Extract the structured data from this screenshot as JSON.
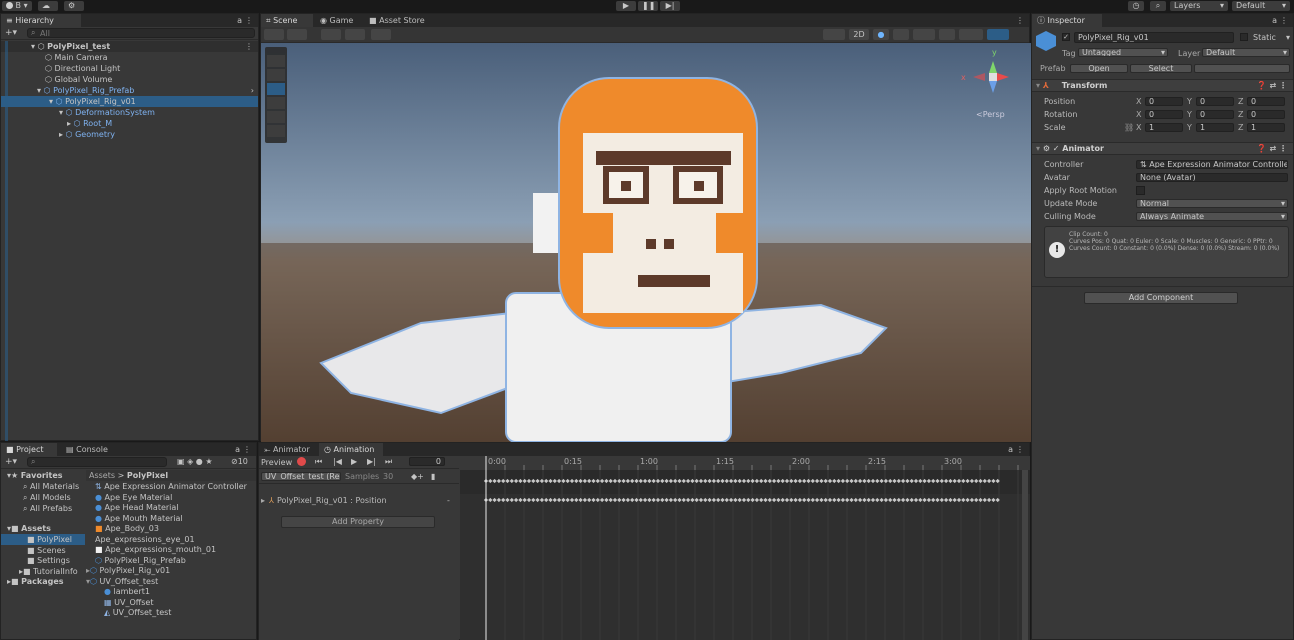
{
  "toolbar": {
    "account_label": "B ▾",
    "layers_label": "Layers",
    "layout_label": "Default"
  },
  "hierarchy": {
    "tab": "Hierarchy",
    "search_placeholder": "All",
    "scene": "PolyPixel_test",
    "items": [
      {
        "label": "Main Camera",
        "blue": false
      },
      {
        "label": "Directional Light",
        "blue": false
      },
      {
        "label": "Global Volume",
        "blue": false
      },
      {
        "label": "PolyPixel_Rig_Prefab",
        "blue": true
      },
      {
        "label": "PolyPixel_Rig_v01",
        "blue": false
      },
      {
        "label": "DeformationSystem",
        "blue": true
      },
      {
        "label": "Root_M",
        "blue": true
      },
      {
        "label": "Geometry",
        "blue": true
      }
    ]
  },
  "scene_tabs": [
    "Scene",
    "Game",
    "Asset Store"
  ],
  "scene": {
    "mode_2d": "2D",
    "persp": "<Persp",
    "axes": {
      "x": "x",
      "y": "y",
      "z": "z"
    }
  },
  "inspector": {
    "tab": "Inspector",
    "object_name": "PolyPixel_Rig_v01",
    "static_label": "Static",
    "tag_label": "Tag",
    "tag_value": "Untagged",
    "layer_label": "Layer",
    "layer_value": "Default",
    "prefab_label": "Prefab",
    "open_btn": "Open",
    "select_btn": "Select",
    "transform": {
      "title": "Transform",
      "rows": [
        {
          "label": "Position",
          "x": "0",
          "y": "0",
          "z": "0"
        },
        {
          "label": "Rotation",
          "x": "0",
          "y": "0",
          "z": "0"
        },
        {
          "label": "Scale",
          "x": "1",
          "y": "1",
          "z": "1"
        }
      ],
      "axis_x": "X",
      "axis_y": "Y",
      "axis_z": "Z"
    },
    "animator": {
      "title": "Animator",
      "controller_label": "Controller",
      "controller_value": "Ape Expression Animator Controlle",
      "avatar_label": "Avatar",
      "avatar_value": "None (Avatar)",
      "root_motion_label": "Apply Root Motion",
      "update_label": "Update Mode",
      "update_value": "Normal",
      "culling_label": "Culling Mode",
      "culling_value": "Always Animate",
      "info_1": "Clip Count: 0",
      "info_2": "Curves Pos: 0 Quat: 0 Euler: 0 Scale: 0 Muscles: 0 Generic: 0 PPtr: 0",
      "info_3": "Curves Count: 0 Constant: 0 (0.0%) Dense: 0 (0.0%) Stream: 0 (0.0%)"
    },
    "add_component": "Add Component"
  },
  "project": {
    "tab": "Project",
    "console_tab": "Console",
    "count": "10",
    "favorites": "Favorites",
    "fav_items": [
      "All Materials",
      "All Models",
      "All Prefabs"
    ],
    "assets": "Assets",
    "asset_folders": [
      "PolyPixel",
      "Scenes",
      "Settings",
      "TutorialInfo"
    ],
    "packages": "Packages",
    "breadcrumb_root": "Assets",
    "breadcrumb_sep": ">",
    "breadcrumb_leaf": "PolyPixel",
    "files": [
      {
        "label": "Ape Expression Animator Controller",
        "indent": 0
      },
      {
        "label": "Ape Eye Material",
        "indent": 0
      },
      {
        "label": "Ape Head Material",
        "indent": 0
      },
      {
        "label": "Ape Mouth Material",
        "indent": 0
      },
      {
        "label": "Ape_Body_03",
        "indent": 0
      },
      {
        "label": "Ape_expressions_eye_01",
        "indent": 0
      },
      {
        "label": "Ape_expressions_mouth_01",
        "indent": 0
      },
      {
        "label": "PolyPixel_Rig_Prefab",
        "indent": 0
      },
      {
        "label": "PolyPixel_Rig_v01",
        "indent": 0
      },
      {
        "label": "UV_Offset_test",
        "indent": 0
      },
      {
        "label": "lambert1",
        "indent": 1
      },
      {
        "label": "UV_Offset",
        "indent": 1
      },
      {
        "label": "UV_Offset_test",
        "indent": 1
      }
    ]
  },
  "animation": {
    "animator_tab": "Animator",
    "animation_tab": "Animation",
    "preview_label": "Preview",
    "frame": "0",
    "clip": "UV_Offset_test (Rea",
    "samples_label": "Samples",
    "samples": "30",
    "property": "PolyPixel_Rig_v01 : Position",
    "add_property": "Add Property",
    "ticks": [
      "0:00",
      "0:15",
      "1:00",
      "1:15",
      "2:00",
      "2:15",
      "3:00"
    ]
  },
  "colors": {
    "accent": "#2c5d87",
    "prefab_blue": "#7fb2f0",
    "panel": "#383838",
    "record": "#e04a4a"
  }
}
